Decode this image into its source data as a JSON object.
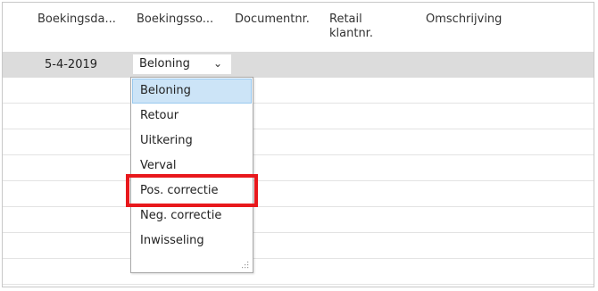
{
  "table": {
    "columns": [
      "Boekingsda...",
      "Boekingsso...",
      "Documentnr.",
      "Retail klantnr.",
      "Omschrijving"
    ],
    "row": {
      "date": "5-4-2019",
      "type": "Beloning"
    }
  },
  "dropdown": {
    "options": [
      "Beloning",
      "Retour",
      "Uitkering",
      "Verval",
      "Pos. correctie",
      "Neg. correctie",
      "Inwisseling"
    ],
    "highlighted": "Beloning",
    "marked_option": "Pos. correctie"
  },
  "icons": {
    "chevron": "chevron-down-icon",
    "grip": "resize-grip-icon"
  },
  "colors": {
    "highlight_border": "#e8181c",
    "option_hover": "#cce4f7",
    "selected_row": "#dcdcdc"
  }
}
